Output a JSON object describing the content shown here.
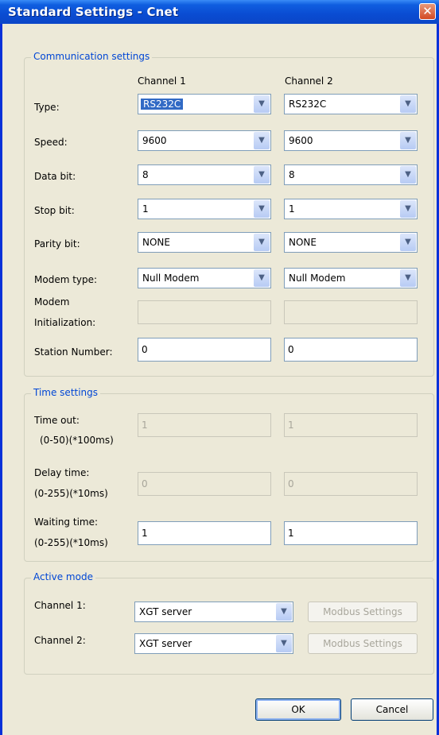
{
  "window": {
    "title": "Standard Settings - Cnet",
    "close_glyph": "✕"
  },
  "communication": {
    "group_title": "Communication settings",
    "channel1_header": "Channel 1",
    "channel2_header": "Channel 2",
    "type": {
      "label": "Type:",
      "ch1": "RS232C",
      "ch2": "RS232C"
    },
    "speed": {
      "label": "Speed:",
      "ch1": "9600",
      "ch2": "9600"
    },
    "data_bit": {
      "label": "Data bit:",
      "ch1": "8",
      "ch2": "8"
    },
    "stop_bit": {
      "label": "Stop bit:",
      "ch1": "1",
      "ch2": "1"
    },
    "parity_bit": {
      "label": "Parity bit:",
      "ch1": "NONE",
      "ch2": "NONE"
    },
    "modem_type": {
      "label": "Modem type:",
      "ch1": "Null Modem",
      "ch2": "Null Modem"
    },
    "modem_init": {
      "label_line1": "Modem",
      "label_line2": "Initialization:",
      "ch1": "",
      "ch2": ""
    },
    "station_number": {
      "label": "Station Number:",
      "ch1": "0",
      "ch2": "0"
    }
  },
  "time": {
    "group_title": "Time settings",
    "time_out": {
      "label_line1": "Time out:",
      "label_line2": "(0-50)(*100ms)",
      "ch1": "1",
      "ch2": "1"
    },
    "delay_time": {
      "label_line1": "Delay time:",
      "label_line2": "(0-255)(*10ms)",
      "ch1": "0",
      "ch2": "0"
    },
    "waiting_time": {
      "label_line1": "Waiting time:",
      "label_line2": "(0-255)(*10ms)",
      "ch1": "1",
      "ch2": "1"
    }
  },
  "active": {
    "group_title": "Active mode",
    "channel1": {
      "label": "Channel 1:",
      "value": "XGT server",
      "button": "Modbus Settings"
    },
    "channel2": {
      "label": "Channel 2:",
      "value": "XGT server",
      "button": "Modbus Settings"
    }
  },
  "footer": {
    "ok_label": "OK",
    "cancel_label": "Cancel"
  },
  "icons": {
    "dropdown_arrow": "chevron-down-icon",
    "close": "close-icon"
  },
  "colors": {
    "titlebar": "#0A4CD2",
    "group_title": "#0046D5",
    "dialog_bg": "#ECE9D8",
    "selection": "#316AC5"
  }
}
